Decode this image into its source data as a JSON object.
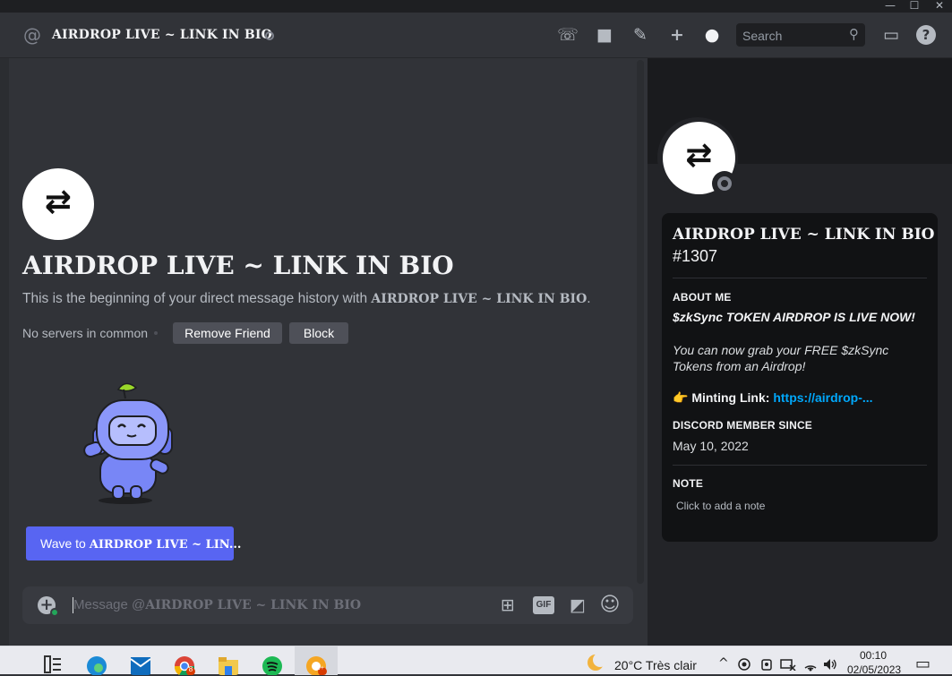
{
  "window": {
    "minimize_glyph": "—",
    "maximize_glyph": "☐",
    "close_glyph": "✕"
  },
  "header": {
    "at_glyph": "@",
    "title": "AIRDROP LIVE ~ LINK IN BIO",
    "icons": {
      "call": "☏",
      "video": "■",
      "pin": "✎",
      "add_friend": "+",
      "profile": "●",
      "inbox": "▭",
      "help": "?"
    },
    "search_placeholder": "Search",
    "search_icon": "⚲"
  },
  "main": {
    "name": "AIRDROP LIVE ~ LINK IN BIO",
    "intro_prefix": "This is the beginning of your direct message history with ",
    "intro_name": "AIRDROP LIVE ~ LINK IN BIO",
    "intro_suffix": ".",
    "mutual": "No servers in common",
    "remove_friend": "Remove Friend",
    "block": "Block",
    "wave_prefix": "Wave to ",
    "wave_name": "AIRDROP LIVE ~ LIN..."
  },
  "composer": {
    "plus_glyph": "+",
    "placeholder_prefix": "Message @",
    "placeholder_name": "AIRDROP LIVE ~ LINK IN BIO",
    "gif_label": "GIF",
    "gift_glyph": "⊞",
    "sticker_glyph": "◩",
    "emoji_glyph": "☺"
  },
  "profile": {
    "arrows_glyph": "⇄",
    "username": "AIRDROP LIVE ~ LINK IN BIO",
    "tag": "#1307",
    "about_title": "ABOUT ME",
    "bio_line1": "$zkSync TOKEN AIRDROP IS LIVE NOW!",
    "bio_line2": "You can now grab your FREE $zkSync Tokens from an Airdrop!",
    "mint_emoji": "👉",
    "mint_label": "Minting Link: ",
    "mint_link": "https://airdrop-...",
    "member_since_title": "DISCORD MEMBER SINCE",
    "member_since": "May 10, 2022",
    "note_title": "NOTE",
    "note_placeholder": "Click to add a note"
  },
  "taskbar": {
    "weather": "20°C  Très clair",
    "time": "00:10",
    "date": "02/05/2023",
    "chrome_badge": "8",
    "app_badge": "9+",
    "tray_glyphs": {
      "chevron": "^",
      "notifications": "▭"
    }
  },
  "colors": {
    "blurple": "#5865f2",
    "bg": "#313338",
    "card": "#111214",
    "link": "#00a8fc",
    "online_green": "#23a55a"
  }
}
